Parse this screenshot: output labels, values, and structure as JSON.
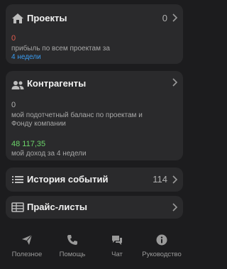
{
  "projects": {
    "title": "Проекты",
    "count": "0",
    "value": "0",
    "description": "прибыль по всем проектам за",
    "period_link": "4 недели"
  },
  "counterparties": {
    "title": "Контрагенты",
    "balance_value": "0",
    "balance_desc": "мой подотчетный баланс по проектам и Фонду компании",
    "income_value": "48 117,35",
    "income_desc": "мой доход за 4 недели"
  },
  "history": {
    "title": "История событий",
    "count": "114"
  },
  "pricelists": {
    "title": "Прайс-листы"
  },
  "tabs": [
    {
      "label": "Полезное",
      "icon": "send-icon"
    },
    {
      "label": "Помощь",
      "icon": "phone-icon"
    },
    {
      "label": "Чат",
      "icon": "chat-icon"
    },
    {
      "label": "Руководство",
      "icon": "info-icon"
    }
  ],
  "colors": {
    "background": "#1c1c1e",
    "card": "#2a2a2c",
    "negative": "#e05a4e",
    "positive": "#6cd46a",
    "link": "#3a9bf0"
  }
}
